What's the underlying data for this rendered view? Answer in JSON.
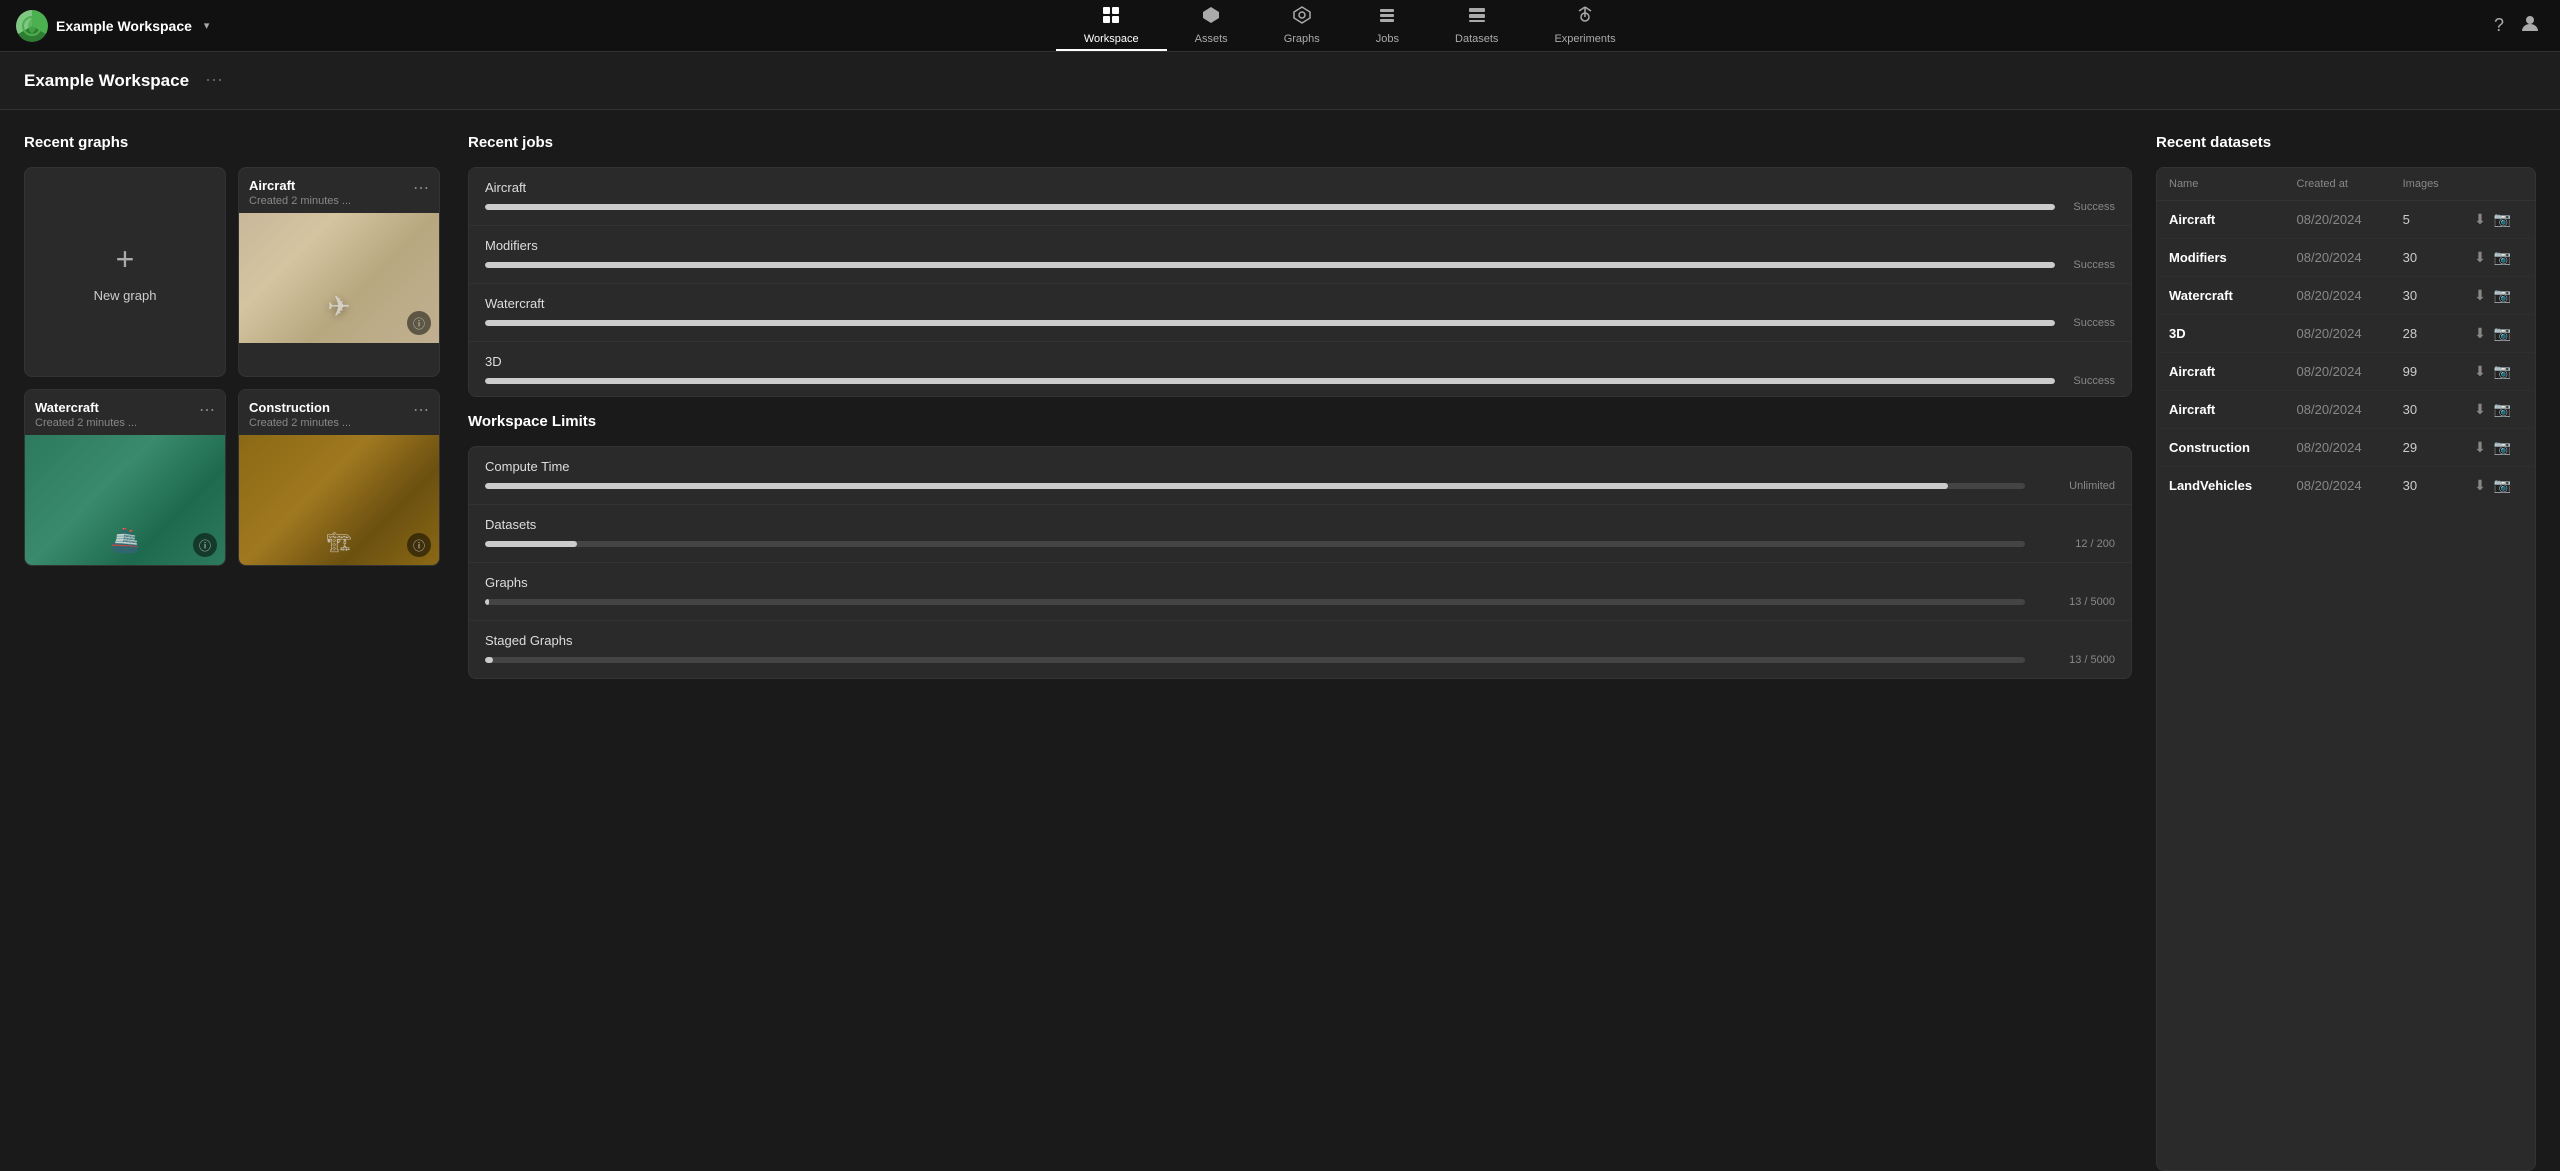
{
  "app": {
    "logo_icon": "🌿",
    "workspace_name": "Example Workspace",
    "workspace_title": "Example Workspace"
  },
  "nav": {
    "tabs": [
      {
        "id": "workspace",
        "label": "Workspace",
        "icon": "⊞",
        "active": true
      },
      {
        "id": "assets",
        "label": "Assets",
        "icon": "◈",
        "active": false
      },
      {
        "id": "graphs",
        "label": "Graphs",
        "icon": "⬡",
        "active": false
      },
      {
        "id": "jobs",
        "label": "Jobs",
        "icon": "☰",
        "active": false
      },
      {
        "id": "datasets",
        "label": "Datasets",
        "icon": "⊟",
        "active": false
      },
      {
        "id": "experiments",
        "label": "Experiments",
        "icon": "✱",
        "active": false
      }
    ]
  },
  "recent_graphs": {
    "section_title": "Recent graphs",
    "new_graph_label": "New graph",
    "cards": [
      {
        "id": "new",
        "type": "new"
      },
      {
        "id": "aircraft",
        "name": "Aircraft",
        "date": "Created 2 minutes ...",
        "thumb_class": "thumb-aircraft"
      },
      {
        "id": "watercraft",
        "name": "Watercraft",
        "date": "Created 2 minutes ...",
        "thumb_class": "thumb-watercraft"
      },
      {
        "id": "construction",
        "name": "Construction",
        "date": "Created 2 minutes ...",
        "thumb_class": "thumb-construction"
      }
    ]
  },
  "recent_jobs": {
    "section_title": "Recent jobs",
    "jobs": [
      {
        "name": "Aircraft",
        "progress": 100,
        "status": "Success"
      },
      {
        "name": "Modifiers",
        "progress": 100,
        "status": "Success"
      },
      {
        "name": "Watercraft",
        "progress": 100,
        "status": "Success"
      },
      {
        "name": "3D",
        "progress": 100,
        "status": "Success"
      }
    ]
  },
  "workspace_limits": {
    "section_title": "Workspace Limits",
    "limits": [
      {
        "name": "Compute Time",
        "bar_width": "95%",
        "value": "Unlimited"
      },
      {
        "name": "Datasets",
        "bar_width": "6%",
        "value": "12 / 200"
      },
      {
        "name": "Graphs",
        "bar_width": "0.26%",
        "value": "13 / 5000"
      },
      {
        "name": "Staged Graphs",
        "bar_width": "0.5%",
        "value": "13 / 5000"
      }
    ]
  },
  "recent_datasets": {
    "section_title": "Recent datasets",
    "columns": [
      "Name",
      "Created at",
      "Images"
    ],
    "rows": [
      {
        "name": "Aircraft",
        "date": "08/20/2024",
        "count": "5"
      },
      {
        "name": "Modifiers",
        "date": "08/20/2024",
        "count": "30"
      },
      {
        "name": "Watercraft",
        "date": "08/20/2024",
        "count": "30"
      },
      {
        "name": "3D",
        "date": "08/20/2024",
        "count": "28"
      },
      {
        "name": "Aircraft",
        "date": "08/20/2024",
        "count": "99"
      },
      {
        "name": "Aircraft",
        "date": "08/20/2024",
        "count": "30"
      },
      {
        "name": "Construction",
        "date": "08/20/2024",
        "count": "29"
      },
      {
        "name": "LandVehicles",
        "date": "08/20/2024",
        "count": "30"
      }
    ]
  }
}
